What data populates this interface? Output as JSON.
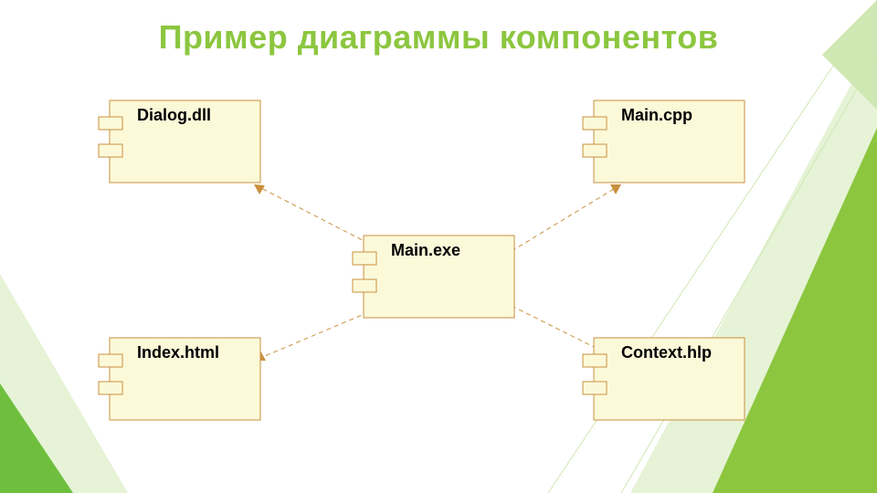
{
  "title": "Пример диаграммы компонентов",
  "chart_data": {
    "type": "diagram",
    "notation": "UML component diagram",
    "components": [
      {
        "id": "dialog",
        "label": "Dialog.dll"
      },
      {
        "id": "maincpp",
        "label": "Main.cpp"
      },
      {
        "id": "mainexe",
        "label": "Main.exe"
      },
      {
        "id": "index",
        "label": "Index.html"
      },
      {
        "id": "context",
        "label": "Context.hlp"
      }
    ],
    "dependencies": [
      {
        "from": "mainexe",
        "to": "dialog"
      },
      {
        "from": "mainexe",
        "to": "maincpp"
      },
      {
        "from": "mainexe",
        "to": "index"
      },
      {
        "from": "mainexe",
        "to": "context"
      }
    ]
  },
  "colors": {
    "accent": "#8cc63f",
    "box_fill": "#fcf9d9",
    "box_stroke": "#c8903e"
  }
}
